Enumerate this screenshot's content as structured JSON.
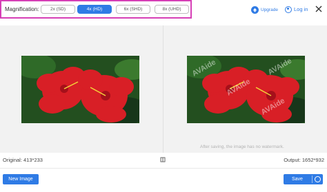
{
  "toolbar": {
    "magnification_label": "Magnification:",
    "options": [
      {
        "label": "2x (SD)",
        "selected": false
      },
      {
        "label": "4x (HD)",
        "selected": true
      },
      {
        "label": "6x (SHD)",
        "selected": false
      },
      {
        "label": "8x (UHD)",
        "selected": false
      }
    ],
    "upgrade_label": "Upgrade",
    "login_label": "Log in"
  },
  "preview": {
    "left_image_desc": "red hibiscus flowers",
    "right_watermark_text": "AVAide",
    "note": "After saving, the image has no watermark."
  },
  "status": {
    "original": "Original: 413*233",
    "output": "Output: 1652*932"
  },
  "actions": {
    "new_image": "New Image",
    "save": "Save"
  },
  "colors": {
    "accent": "#2f7be5",
    "highlight_border": "#d63fb6",
    "panel_bg": "#f2f2f2"
  }
}
